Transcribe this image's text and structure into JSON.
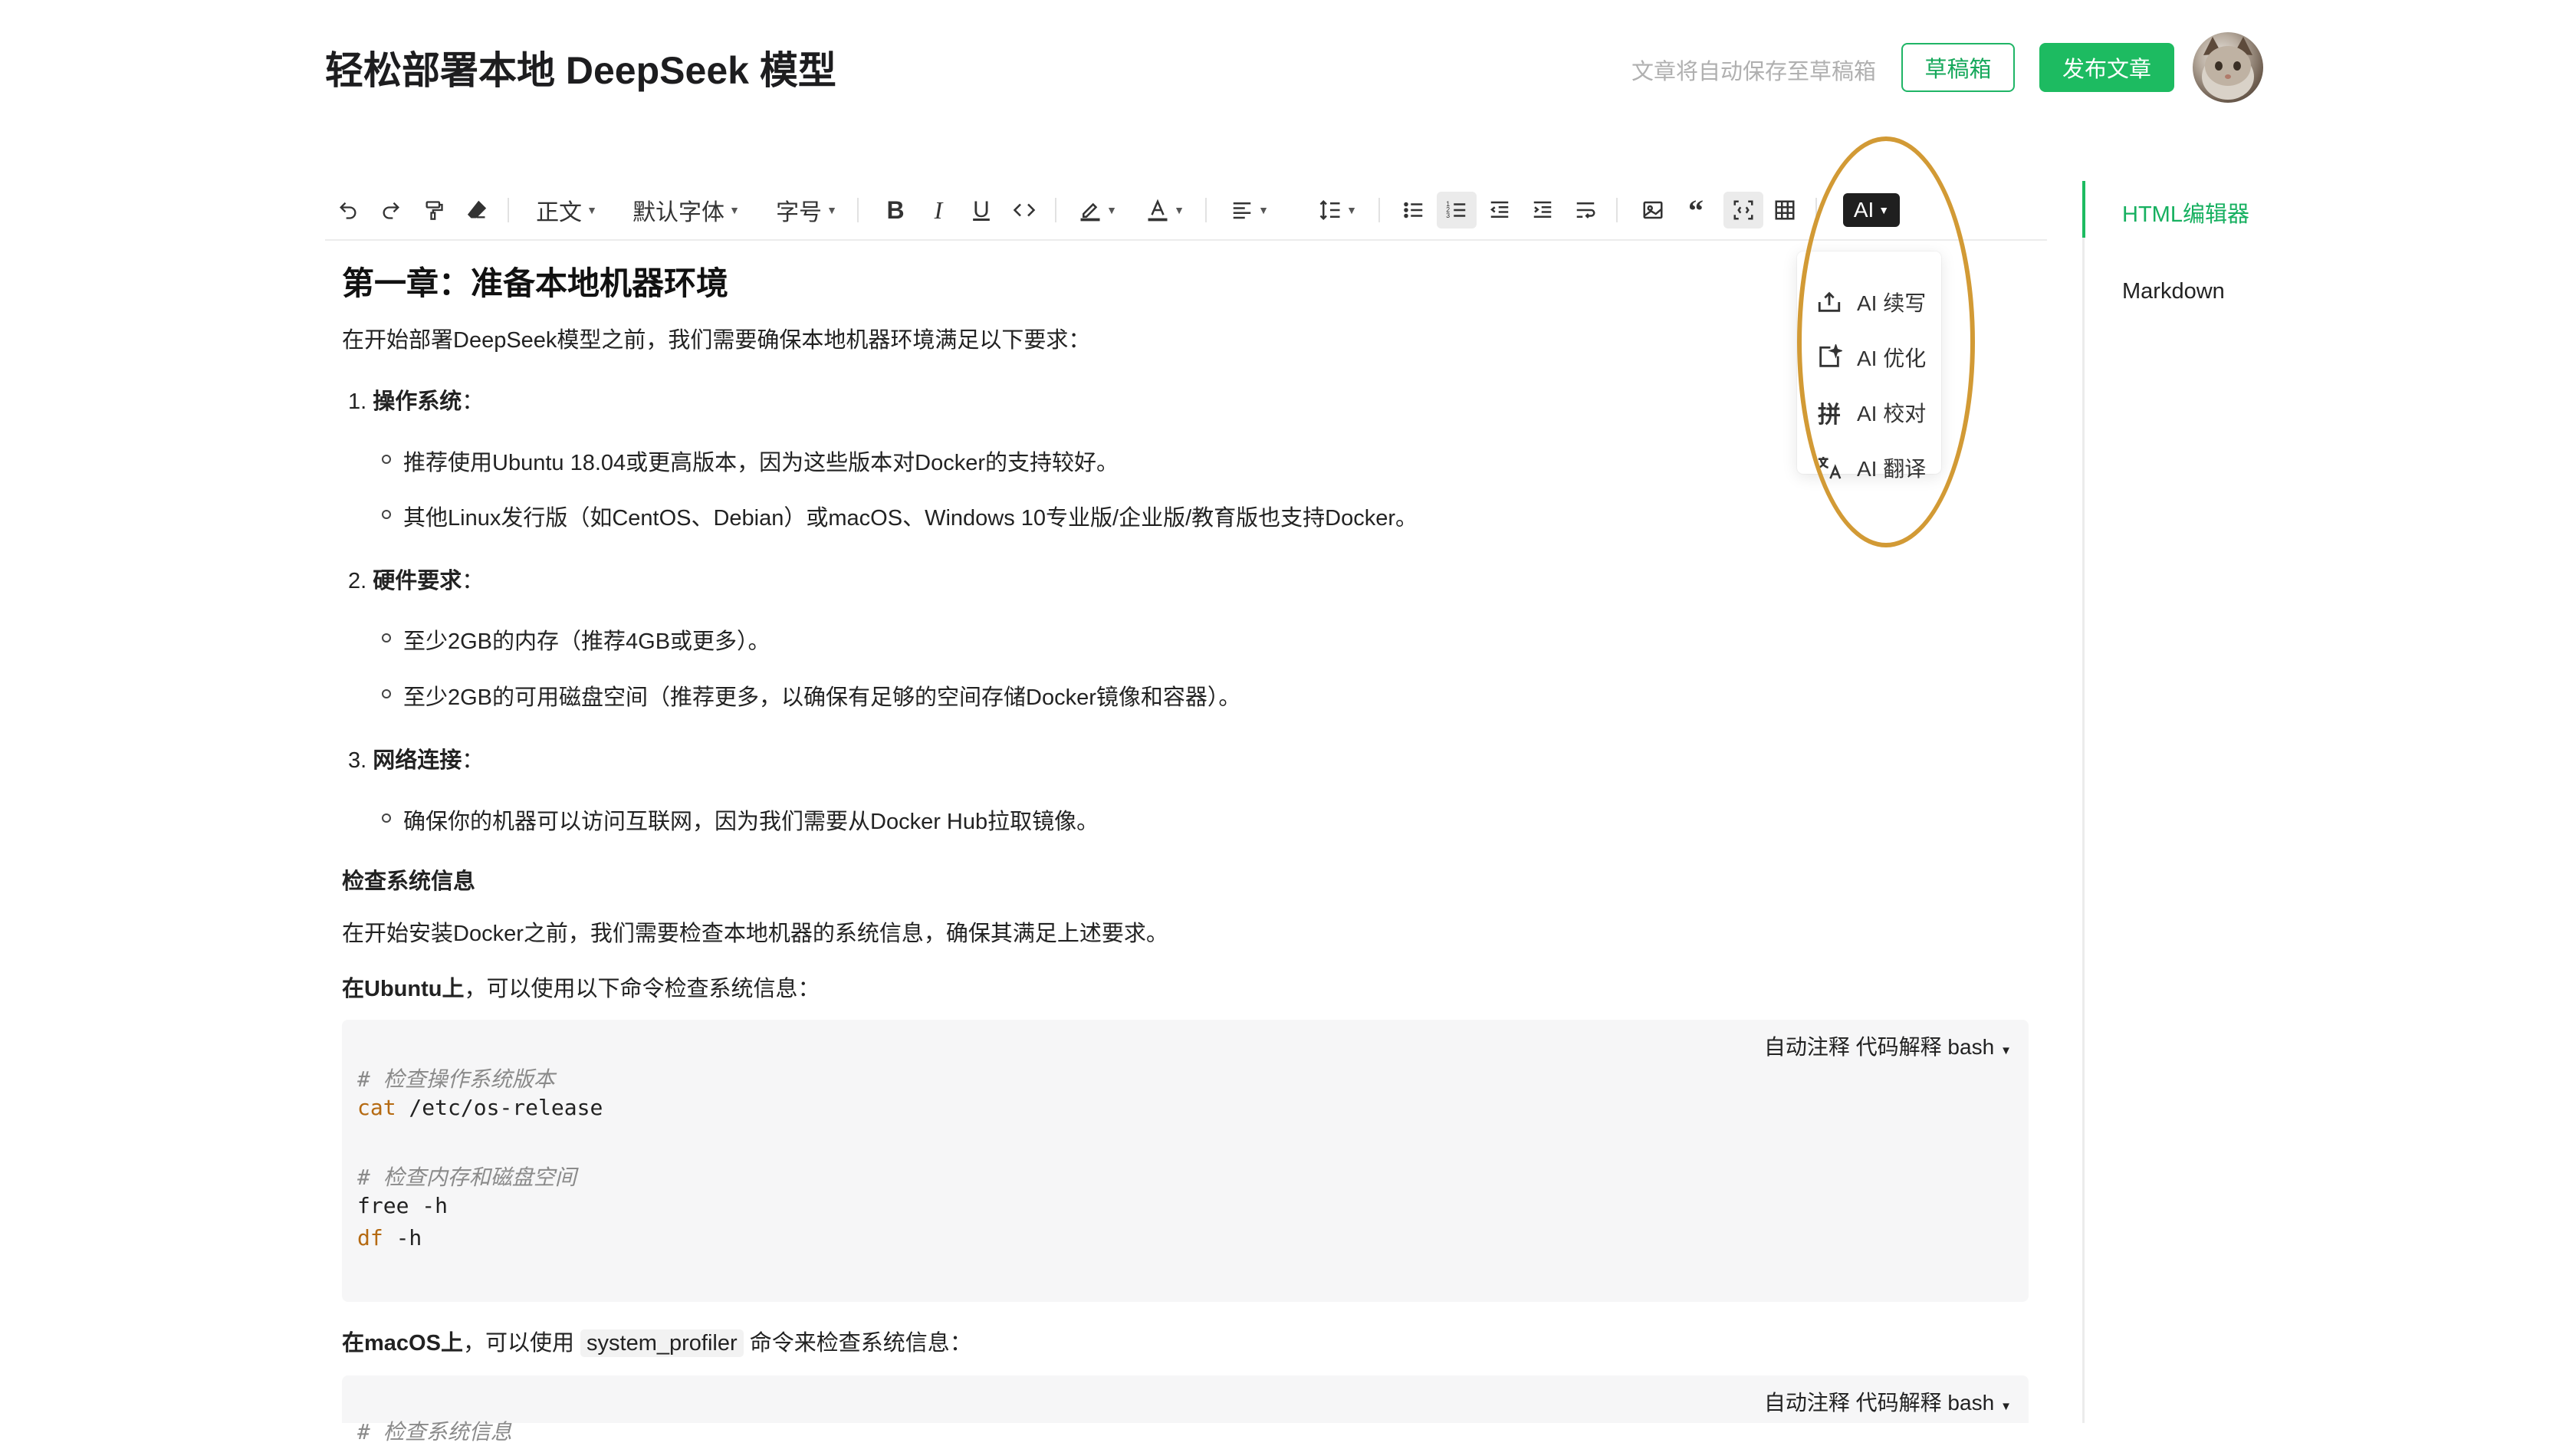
{
  "header": {
    "title": "轻松部署本地 DeepSeek 模型",
    "autosave_hint": "文章将自动保存至草稿箱",
    "draft_label": "草稿箱",
    "publish_label": "发布文章"
  },
  "toolbar": {
    "paragraph": "正文",
    "font": "默认字体",
    "font_size": "字号",
    "ai": "AI"
  },
  "ai_menu": [
    {
      "label": "AI 续写",
      "icon": "export-icon"
    },
    {
      "label": "AI 优化",
      "icon": "sparkle-icon"
    },
    {
      "label": "AI 校对",
      "icon": "pinyin-icon"
    },
    {
      "label": "AI 翻译",
      "icon": "translate-icon"
    }
  ],
  "sidebar": {
    "tabs": [
      "HTML编辑器",
      "Markdown"
    ]
  },
  "content": {
    "h1": "第一章：准备本地机器环境",
    "intro": "在开始部署DeepSeek模型之前，我们需要确保本地机器环境满足以下要求：",
    "items": [
      {
        "num": "1.",
        "title": "操作系统",
        "colon": "：",
        "bullets": [
          "推荐使用Ubuntu 18.04或更高版本，因为这些版本对Docker的支持较好。",
          "其他Linux发行版（如CentOS、Debian）或macOS、Windows 10专业版/企业版/教育版也支持Docker。"
        ]
      },
      {
        "num": "2.",
        "title": "硬件要求",
        "colon": "：",
        "bullets": [
          "至少2GB的内存（推荐4GB或更多）。",
          "至少2GB的可用磁盘空间（推荐更多，以确保有足够的空间存储Docker镜像和容器）。"
        ]
      },
      {
        "num": "3.",
        "title": "网络连接",
        "colon": "：",
        "bullets": [
          "确保你的机器可以访问互联网，因为我们需要从Docker Hub拉取镜像。"
        ]
      }
    ],
    "check_title": "检查系统信息",
    "check_desc": "在开始安装Docker之前，我们需要检查本地机器的系统信息，确保其满足上述要求。",
    "ubuntu_bold": "在Ubuntu上",
    "ubuntu_rest": "，可以使用以下命令检查系统信息：",
    "code1": {
      "meta": "自动注释  代码解释  bash",
      "c1": "# 检查操作系统版本",
      "l1_kw": "cat",
      "l1_rest": " /etc/os-release",
      "c2": "# 检查内存和磁盘空间",
      "l2": "free -h",
      "l3_kw": "df",
      "l3_rest": " -h"
    },
    "mac_bold": "在macOS上",
    "mac_mid": "，可以使用 ",
    "mac_code": "system_profiler",
    "mac_rest": " 命令来检查系统信息：",
    "code2": {
      "meta": "自动注释  代码解释  bash",
      "c1": "# 检查系统信息"
    }
  }
}
